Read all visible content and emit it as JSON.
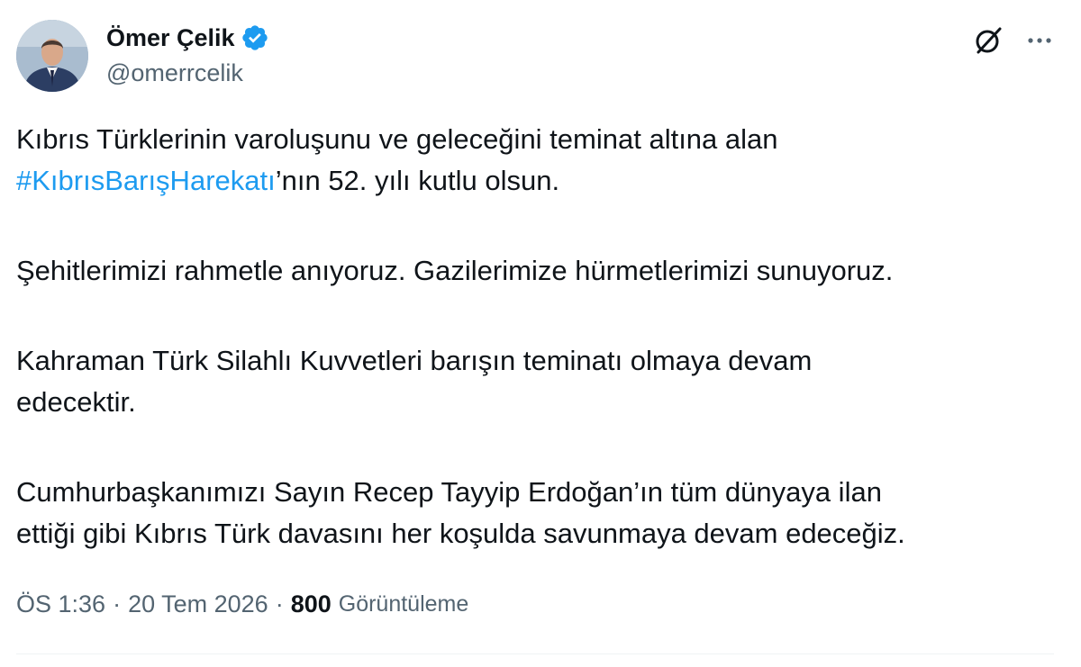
{
  "author": {
    "display_name": "Ömer Çelik",
    "handle": "@omerrcelik",
    "verified_color": "#1d9bf0"
  },
  "icons": {
    "verified": "verified-badge-icon",
    "grok": "grok-icon",
    "more": "more-options-icon"
  },
  "tweet": {
    "paragraph1_line1": "Kıbrıs Türklerinin varoluşunu ve geleceğini teminat altına alan",
    "paragraph1_hashtag": "#KıbrısBarışHarekatı",
    "paragraph1_rest": "’nın 52. yılı kutlu olsun.",
    "paragraph2": "Şehitlerimizi rahmetle anıyoruz. Gazilerimize hürmetlerimizi sunuyoruz.",
    "paragraph3_line1": "Kahraman Türk Silahlı Kuvvetleri barışın teminatı olmaya devam",
    "paragraph3_line2": "edecektir.",
    "paragraph4_line1": "Cumhurbaşkanımızı Sayın Recep Tayyip Erdoğan’ın tüm dünyaya ilan",
    "paragraph4_line2": "ettiği gibi Kıbrıs Türk davasını her koşulda savunmaya devam edeceğiz."
  },
  "meta": {
    "time": "ÖS 1:36",
    "separator": "·",
    "date": "20 Tem 2026",
    "views_count": "800",
    "views_label": "Görüntüleme"
  },
  "colors": {
    "text": "#0f1419",
    "secondary": "#536471",
    "link": "#1d9bf0"
  }
}
